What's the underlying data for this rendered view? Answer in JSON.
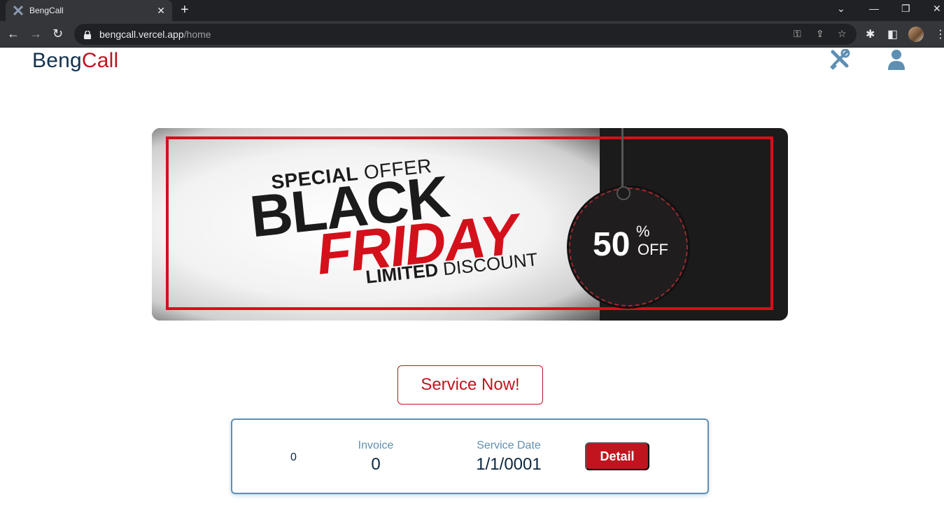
{
  "browser": {
    "tab_title": "BengCall",
    "tab_close": "✕",
    "new_tab": "+",
    "url_host": "bengcall.vercel.app",
    "url_path": "/home"
  },
  "header": {
    "brand_part1": "Beng",
    "brand_part2": "Call",
    "icons": [
      "tools-icon",
      "user-icon"
    ]
  },
  "banner": {
    "special": "SPECIAL",
    "offer": " OFFER",
    "black": "BLACK",
    "friday": "FRIDAY",
    "limited": "LIMITED",
    "discount": " DISCOUNT",
    "percent_value": "50",
    "percent_sign": "%",
    "off": "OFF"
  },
  "cta": {
    "label": "Service Now!"
  },
  "service_card": {
    "index": "0",
    "invoice_label": "Invoice",
    "invoice_value": "0",
    "date_label": "Service Date",
    "date_value": "1/1/0001",
    "detail_label": "Detail"
  },
  "colors": {
    "brand_dark": "#13324e",
    "brand_red": "#c0141f",
    "accent_blue": "#5f8fb3"
  }
}
